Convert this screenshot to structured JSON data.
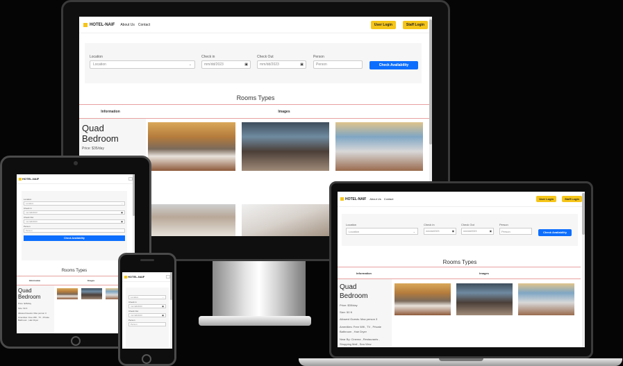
{
  "site": {
    "brand": "HOTEL-NAIF",
    "nav_about": "About Us",
    "nav_contact": "Contact",
    "user_login": "User Login",
    "staff_login": "Staff Login"
  },
  "search": {
    "location_label": "Location",
    "location_value": "Location",
    "checkin_label": "Check in",
    "checkin_value": "mm/dd/2023",
    "checkout_label": "Check Out",
    "checkout_value": "mm/dd/2023",
    "person_label": "Person",
    "person_placeholder": "Person",
    "button": "Check Availability"
  },
  "rooms": {
    "section_title": "Rooms Types",
    "col_information": "Information",
    "col_images": "Images",
    "room_name": "Quad Bedroom",
    "price": "Price: $35/day",
    "size": "Size: 50 ft",
    "guests": "Allowed Guests: Max person 3",
    "amenities": "Amenities: Free Wifi , TV , Private Bathroom , Hair Dryer",
    "area": "Near By: Cinema , Restaurants , Shopping Mall , Sea View"
  },
  "icons": {
    "brand": "hotel-logo-icon",
    "calendar": "calendar-icon",
    "dropdown": "chevron-down-icon"
  },
  "colors": {
    "accent_yellow": "#f5c518",
    "primary_blue": "#0d6efd",
    "table_border": "#e8a0a0"
  }
}
